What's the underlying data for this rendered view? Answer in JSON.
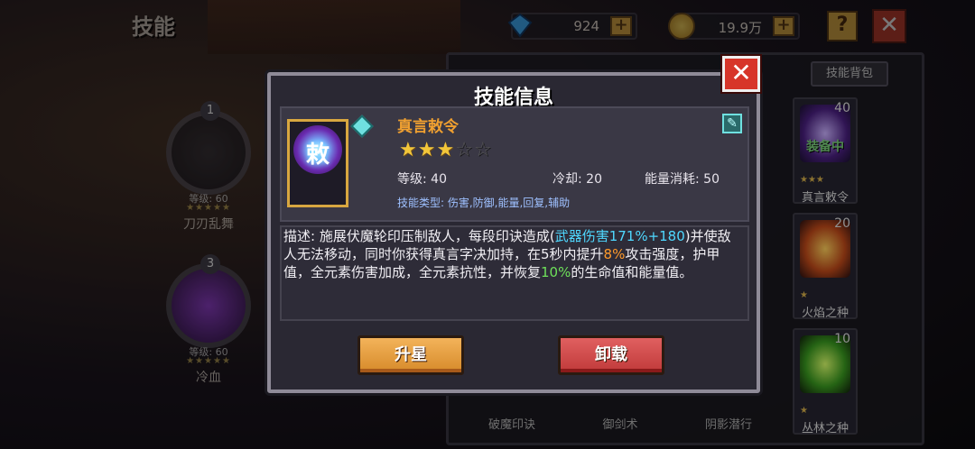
{
  "page": {
    "title": "技能"
  },
  "currency": {
    "gems": "924",
    "gold": "19.9万"
  },
  "top_buttons": {
    "help": "?",
    "close": "✕"
  },
  "left_slots": [
    {
      "index": "1",
      "level": "等级: 60",
      "stars": "★★★★★",
      "name": "刀刃乱舞"
    },
    {
      "index": "3",
      "level": "等级: 60",
      "stars": "★★★★★",
      "name": "冷血"
    }
  ],
  "backpack": {
    "tab_label": "技能背包",
    "items": [
      {
        "count": "40",
        "stars": "★★★",
        "name": "真言敕令",
        "badge": "装备中"
      },
      {
        "count": "20",
        "stars": "★",
        "name": "火焰之种"
      },
      {
        "count": "10",
        "stars": "★",
        "name": "丛林之种"
      }
    ],
    "bottom_names": [
      "破魔印诀",
      "御剑术",
      "阴影潜行"
    ]
  },
  "modal": {
    "title": "技能信息",
    "close": "✕",
    "skill_name": "真言敕令",
    "icon_glyph": "敕",
    "stars_filled": 3,
    "stars_total": 5,
    "level_label": "等级: 40",
    "cooldown_label": "冷却: 20",
    "energy_label": "能量消耗: 50",
    "type_label": "技能类型: 伤害,防御,能量,回复,辅助",
    "desc_1": "描述: 施展伏魔轮印压制敌人，每段印诀造成(",
    "desc_dmg": "武器伤害171%+180",
    "desc_2": ")并使敌人无法移动，同时你获得真言字决加持，在5秒内提升",
    "desc_pct1": "8%",
    "desc_3": "攻击强度，护甲值，全元素伤害加成，全元素抗性，并恢复",
    "desc_pct2": "10%",
    "desc_4": "的生命值和能量值。",
    "btn_upgrade": "升星",
    "btn_unequip": "卸载"
  },
  "colors": {
    "accent_orange": "#f0a030",
    "highlight_cyan": "#4fd8ff",
    "highlight_green": "#6ee05a",
    "close_red": "#d7352a"
  }
}
